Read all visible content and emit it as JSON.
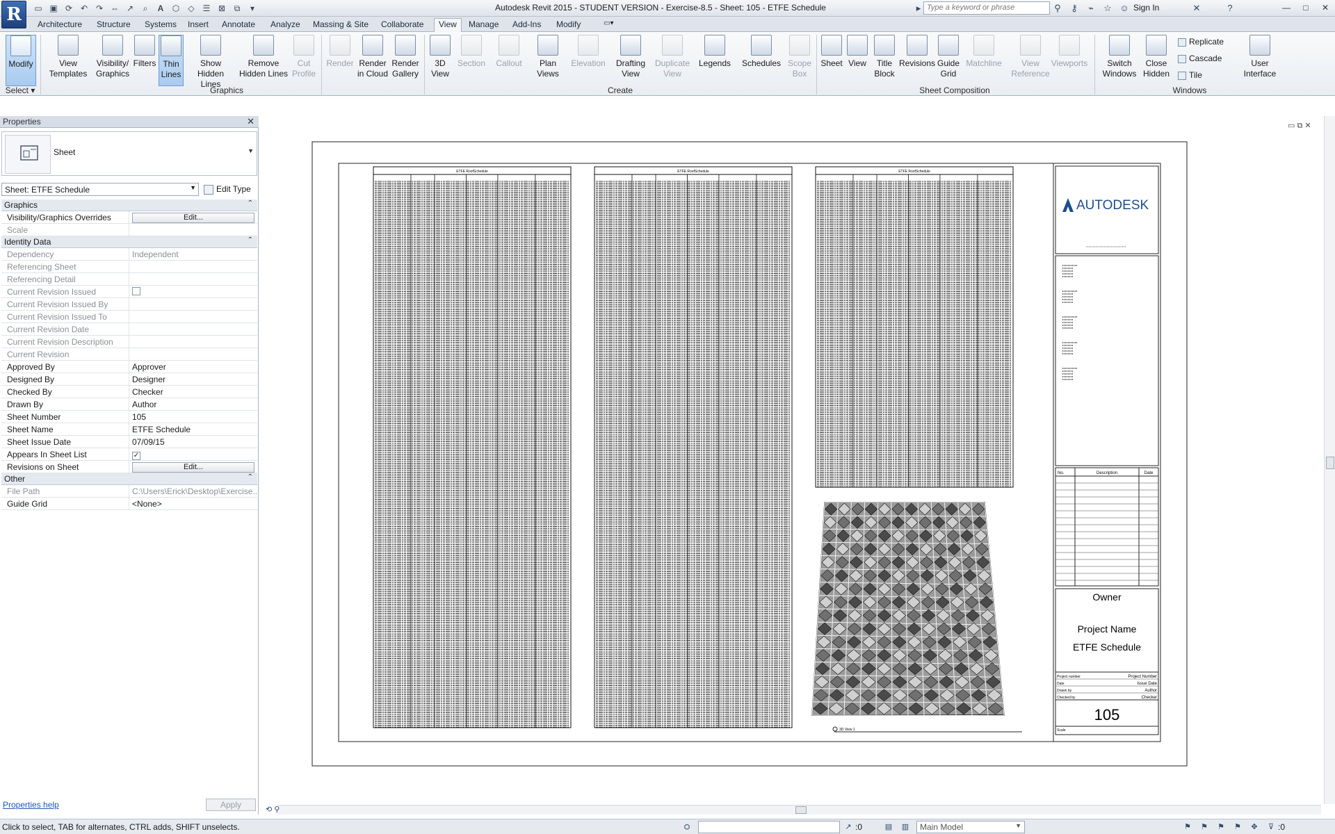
{
  "app": {
    "window_title": "Autodesk Revit 2015 - STUDENT VERSION -     Exercise-8.5 - Sheet: 105 - ETFE Schedule",
    "app_button": "R",
    "search_placeholder": "Type a keyword or phrase",
    "sign_in": "Sign In"
  },
  "tabs": [
    "Architecture",
    "Structure",
    "Systems",
    "Insert",
    "Annotate",
    "Analyze",
    "Massing & Site",
    "Collaborate",
    "View",
    "Manage",
    "Add-Ins",
    "Modify"
  ],
  "active_tab": "View",
  "ribbon": {
    "select": {
      "modify": "Modify",
      "panel": "Select"
    },
    "graphics": {
      "panel": "Graphics",
      "view_templates": [
        "View",
        "Templates"
      ],
      "visibility_graphics": [
        "Visibility/",
        "Graphics"
      ],
      "filters": "Filters",
      "thin_lines": [
        "Thin",
        "Lines"
      ],
      "show_hidden": [
        "Show",
        "Hidden Lines"
      ],
      "remove_hidden": [
        "Remove",
        "Hidden Lines"
      ],
      "cut_profile": [
        "Cut",
        "Profile"
      ]
    },
    "presentation": {
      "render": "Render",
      "render_cloud": [
        "Render",
        "in Cloud"
      ],
      "render_gallery": [
        "Render",
        "Gallery"
      ]
    },
    "create": {
      "panel": "Create",
      "view_3d": [
        "3D",
        "View"
      ],
      "section": "Section",
      "callout": "Callout",
      "plan_views": [
        "Plan",
        "Views"
      ],
      "elevation": "Elevation",
      "drafting_view": [
        "Drafting",
        "View"
      ],
      "duplicate_view": [
        "Duplicate",
        "View"
      ],
      "legends": "Legends",
      "schedules": "Schedules",
      "scope_box": [
        "Scope",
        "Box"
      ]
    },
    "sheet_composition": {
      "panel": "Sheet Composition",
      "sheet": "Sheet",
      "view": "View",
      "title_block": [
        "Title",
        "Block"
      ],
      "revisions": "Revisions",
      "guide_grid": [
        "Guide",
        "Grid"
      ],
      "matchline": "Matchline",
      "view_reference": [
        "View",
        "Reference"
      ],
      "viewports": "Viewports"
    },
    "windows": {
      "panel": "Windows",
      "switch_windows": [
        "Switch",
        "Windows"
      ],
      "close_hidden": [
        "Close",
        "Hidden"
      ],
      "replicate": "Replicate",
      "cascade": "Cascade",
      "tile": "Tile",
      "user_interface": [
        "User",
        "Interface"
      ]
    }
  },
  "properties": {
    "header": "Properties",
    "type_name": "Sheet",
    "instance_selector": "Sheet: ETFE Schedule",
    "edit_type": "Edit Type",
    "groups": [
      {
        "name": "Graphics",
        "rows": [
          {
            "name": "Visibility/Graphics Overrides",
            "value": "Edit...",
            "kind": "button"
          },
          {
            "name": "Scale",
            "value": "",
            "kind": "text",
            "readonly": true
          }
        ]
      },
      {
        "name": "Identity Data",
        "rows": [
          {
            "name": "Dependency",
            "value": "Independent",
            "kind": "text",
            "readonly": true
          },
          {
            "name": "Referencing Sheet",
            "value": "",
            "kind": "text",
            "readonly": true
          },
          {
            "name": "Referencing Detail",
            "value": "",
            "kind": "text",
            "readonly": true
          },
          {
            "name": "Current Revision Issued",
            "value": "",
            "kind": "checkbox",
            "readonly": true
          },
          {
            "name": "Current Revision Issued By",
            "value": "",
            "kind": "text",
            "readonly": true
          },
          {
            "name": "Current Revision Issued To",
            "value": "",
            "kind": "text",
            "readonly": true
          },
          {
            "name": "Current Revision Date",
            "value": "",
            "kind": "text",
            "readonly": true
          },
          {
            "name": "Current Revision Description",
            "value": "",
            "kind": "text",
            "readonly": true
          },
          {
            "name": "Current Revision",
            "value": "",
            "kind": "text",
            "readonly": true
          },
          {
            "name": "Approved By",
            "value": "Approver",
            "kind": "text"
          },
          {
            "name": "Designed By",
            "value": "Designer",
            "kind": "text"
          },
          {
            "name": "Checked By",
            "value": "Checker",
            "kind": "text"
          },
          {
            "name": "Drawn By",
            "value": "Author",
            "kind": "text"
          },
          {
            "name": "Sheet Number",
            "value": "105",
            "kind": "text"
          },
          {
            "name": "Sheet Name",
            "value": "ETFE Schedule",
            "kind": "text"
          },
          {
            "name": "Sheet Issue Date",
            "value": "07/09/15",
            "kind": "text"
          },
          {
            "name": "Appears In Sheet List",
            "value": "✓",
            "kind": "checkbox"
          },
          {
            "name": "Revisions on Sheet",
            "value": "Edit...",
            "kind": "button"
          }
        ]
      },
      {
        "name": "Other",
        "rows": [
          {
            "name": "File Path",
            "value": "C:\\Users\\Erick\\Desktop\\Exercise...",
            "kind": "text",
            "readonly": true
          },
          {
            "name": "Guide Grid",
            "value": "<None>",
            "kind": "text"
          }
        ]
      }
    ],
    "help_link": "Properties help",
    "apply": "Apply"
  },
  "sheet": {
    "schedule_title": "ETFE RoofSchedule",
    "logo_text": "AUTODESK",
    "owner": "Owner",
    "project_name": "Project Name",
    "sheet_name": "ETFE Schedule",
    "sheet_number": "105",
    "rev_headers": [
      "No.",
      "Description",
      "Date"
    ],
    "info_rows": [
      {
        "label": "Project number",
        "value": "Project Number"
      },
      {
        "label": "Date",
        "value": "Issue Date"
      },
      {
        "label": "Drawn by",
        "value": "Author"
      },
      {
        "label": "Checked by",
        "value": "Checker"
      }
    ],
    "scale_label": "Scale",
    "view_label": "3D View 1"
  },
  "statusbar": {
    "message": "Click to select, TAB for alternates, CTRL adds, SHIFT unselects.",
    "zero_count": ":0",
    "model": "Main Model"
  },
  "colors": {
    "accent": "#3f6fb5",
    "autodesk_logo": "#1f4e8c"
  }
}
